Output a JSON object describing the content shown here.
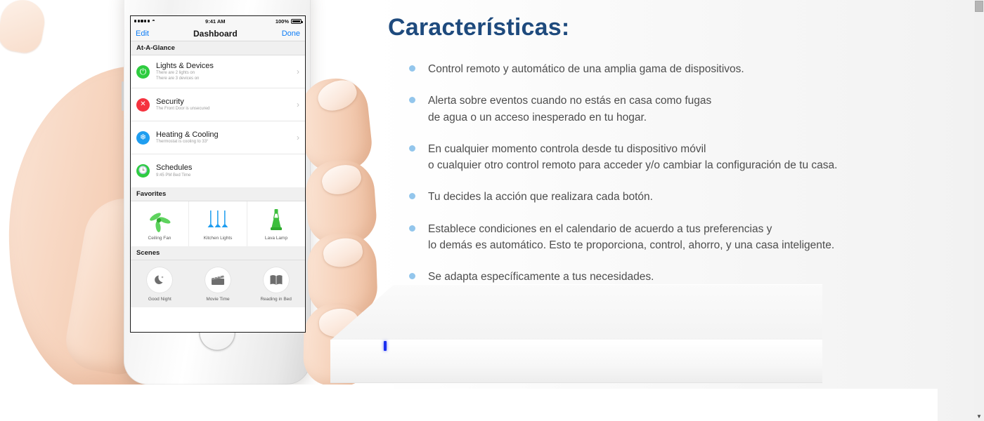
{
  "phone": {
    "status_bar": {
      "signal_dots": 5,
      "wifi_icon": "wifi-icon",
      "time": "9:41 AM",
      "battery_percent": "100%",
      "battery_icon": "battery-full-icon"
    },
    "nav": {
      "left_button": "Edit",
      "title": "Dashboard",
      "right_button": "Done"
    },
    "sections": [
      {
        "header": "At-A-Glance",
        "rows": [
          {
            "icon": "power-icon",
            "icon_color": "#2ecc40",
            "title": "Lights & Devices",
            "subtitle": "There are 2 lights on\nThere are 3 devices on",
            "chevron": "chevron-right-icon"
          },
          {
            "icon": "close-icon",
            "icon_color": "#f5333f",
            "title": "Security",
            "subtitle": "The Front Door is unsecured",
            "chevron": "chevron-right-icon"
          },
          {
            "icon": "snowflake-icon",
            "icon_color": "#1f9ef0",
            "title": "Heating & Cooling",
            "subtitle": "Thermostat is cooling to 33°",
            "chevron": "chevron-right-icon"
          },
          {
            "icon": "clock-icon",
            "icon_color": "#2ecc40",
            "title": "Schedules",
            "subtitle": "9:45 PM Bed Time",
            "chevron": ""
          }
        ]
      },
      {
        "header": "Favorites",
        "tiles": [
          {
            "icon": "ceiling-fan-icon",
            "label": "Ceiling Fan",
            "color": "#4ec94e"
          },
          {
            "icon": "kitchen-lights-icon",
            "label": "Kitchen Lights",
            "color": "#1f9ef0"
          },
          {
            "icon": "lava-lamp-icon",
            "label": "Lava Lamp",
            "color": "#2ecc40"
          }
        ]
      },
      {
        "header": "Scenes",
        "scenes": [
          {
            "icon": "moon-icon",
            "label": "Good Night"
          },
          {
            "icon": "clapperboard-icon",
            "label": "Movie Time"
          },
          {
            "icon": "open-book-icon",
            "label": "Reading in Bed"
          }
        ]
      }
    ]
  },
  "content": {
    "title": "Características:",
    "title_color": "#1e4a7d",
    "bullet_color": "#93c6ec",
    "features": [
      "Control remoto y automático de una amplia gama de dispositivos.",
      "Alerta sobre eventos cuando no estás en casa como fugas\nde agua o un acceso inesperado en tu hogar.",
      "En cualquier momento controla desde tu dispositivo móvil\no cualquier otro control remoto para acceder y/o cambiar la configuración de tu casa.",
      "Tu decides la acción que realizara cada botón.",
      "Establece condiciones en el calendario de acuerdo a tus preferencias y\nlo demás es automático. Esto te proporciona, control, ahorro, y una casa inteligente.",
      "Se adapta específicamente a tus necesidades."
    ]
  },
  "hub": {
    "led_color": "#1a2ef0",
    "name": "smart-home-hub"
  },
  "scrollbar": {
    "down_arrow": "▼"
  }
}
